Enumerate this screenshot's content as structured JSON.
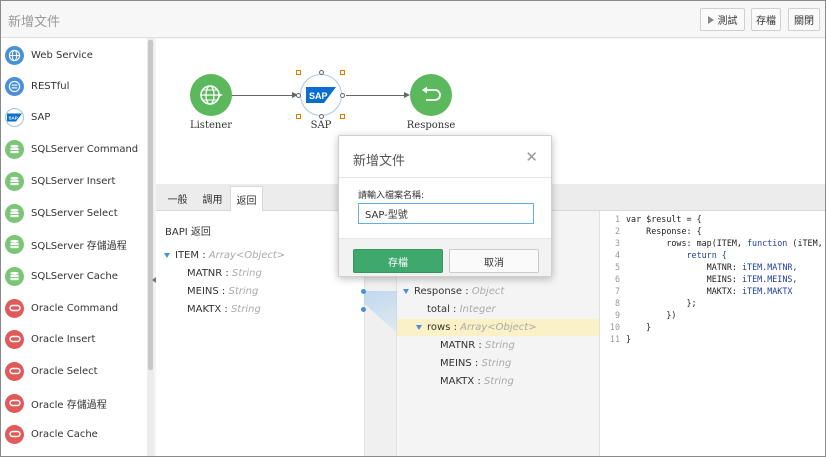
{
  "header": {
    "title": "新增文件",
    "buttons": {
      "test": "測試",
      "save": "存檔",
      "close": "關閉"
    }
  },
  "sidebar": {
    "items": [
      {
        "label": "Web Service",
        "icon": "globe-icon",
        "color": "#4a90d9"
      },
      {
        "label": "RESTful",
        "icon": "exchange-icon",
        "color": "#4a90d9"
      },
      {
        "label": "SAP",
        "icon": "sap-logo-icon",
        "color": "#0a6ed1"
      },
      {
        "label": "SQLServer Command",
        "icon": "database-icon",
        "color": "#7cc576"
      },
      {
        "label": "SQLServer Insert",
        "icon": "database-icon",
        "color": "#7cc576"
      },
      {
        "label": "SQLServer Select",
        "icon": "database-icon",
        "color": "#7cc576"
      },
      {
        "label": "SQLServer 存儲過程",
        "icon": "database-icon",
        "color": "#7cc576"
      },
      {
        "label": "SQLServer Cache",
        "icon": "database-icon",
        "color": "#7cc576"
      },
      {
        "label": "Oracle Command",
        "icon": "oracle-icon",
        "color": "#e15a5a"
      },
      {
        "label": "Oracle Insert",
        "icon": "oracle-icon",
        "color": "#e15a5a"
      },
      {
        "label": "Oracle Select",
        "icon": "oracle-icon",
        "color": "#e15a5a"
      },
      {
        "label": "Oracle 存儲過程",
        "icon": "oracle-icon",
        "color": "#e15a5a"
      },
      {
        "label": "Oracle Cache",
        "icon": "oracle-icon",
        "color": "#e15a5a"
      }
    ]
  },
  "flow": {
    "nodes": [
      {
        "label": "Listener",
        "icon": "globe-icon",
        "color": "#5cb85c"
      },
      {
        "label": "SAP",
        "icon": "sap-logo-icon",
        "color": "#0a6ed1"
      },
      {
        "label": "Response",
        "icon": "return-arrow-icon",
        "color": "#5cb85c"
      }
    ]
  },
  "tabs": [
    {
      "label": "一般"
    },
    {
      "label": "調用"
    },
    {
      "label": "返回",
      "active": true
    }
  ],
  "left_panel": {
    "title": "BAPI 返回",
    "root": {
      "name": "ITEM",
      "type": "Array<Object>"
    },
    "fields": [
      {
        "name": "MATNR",
        "type": "String"
      },
      {
        "name": "MEINS",
        "type": "String"
      },
      {
        "name": "MAKTX",
        "type": "String"
      }
    ]
  },
  "right_tree": {
    "root": {
      "name": "Response",
      "type": "Object"
    },
    "total": {
      "name": "total",
      "type": "Integer"
    },
    "rows": {
      "name": "rows",
      "type": "Array<Object>"
    },
    "fields": [
      {
        "name": "MATNR",
        "type": "String"
      },
      {
        "name": "MEINS",
        "type": "String"
      },
      {
        "name": "MAKTX",
        "type": "String"
      }
    ]
  },
  "code": {
    "line_numbers": [
      "1",
      "2",
      "3",
      "4",
      "5",
      "6",
      "7",
      "8",
      "9",
      "10",
      "11"
    ],
    "line1": "var $result = {",
    "line2": "    Response: {",
    "line3_pre": "        rows: map(ITEM, ",
    "line3_kw": "function",
    "line3_post": " (iTEM,",
    "line4": "            return {",
    "line5_pre": "                MATNR: ",
    "line5_fld": "iTEM.MATNR,",
    "line6_pre": "                MEINS: ",
    "line6_fld": "iTEM.MEINS,",
    "line7_pre": "                MAKTX: ",
    "line7_fld": "iTEM.MAKTX",
    "line8": "            };",
    "line9": "        })",
    "line10": "    }",
    "line11": "}"
  },
  "dialog": {
    "title": "新增文件",
    "label": "請輸入檔案名稱:",
    "input_value": "SAP-型號",
    "save": "存檔",
    "cancel": "取消"
  }
}
